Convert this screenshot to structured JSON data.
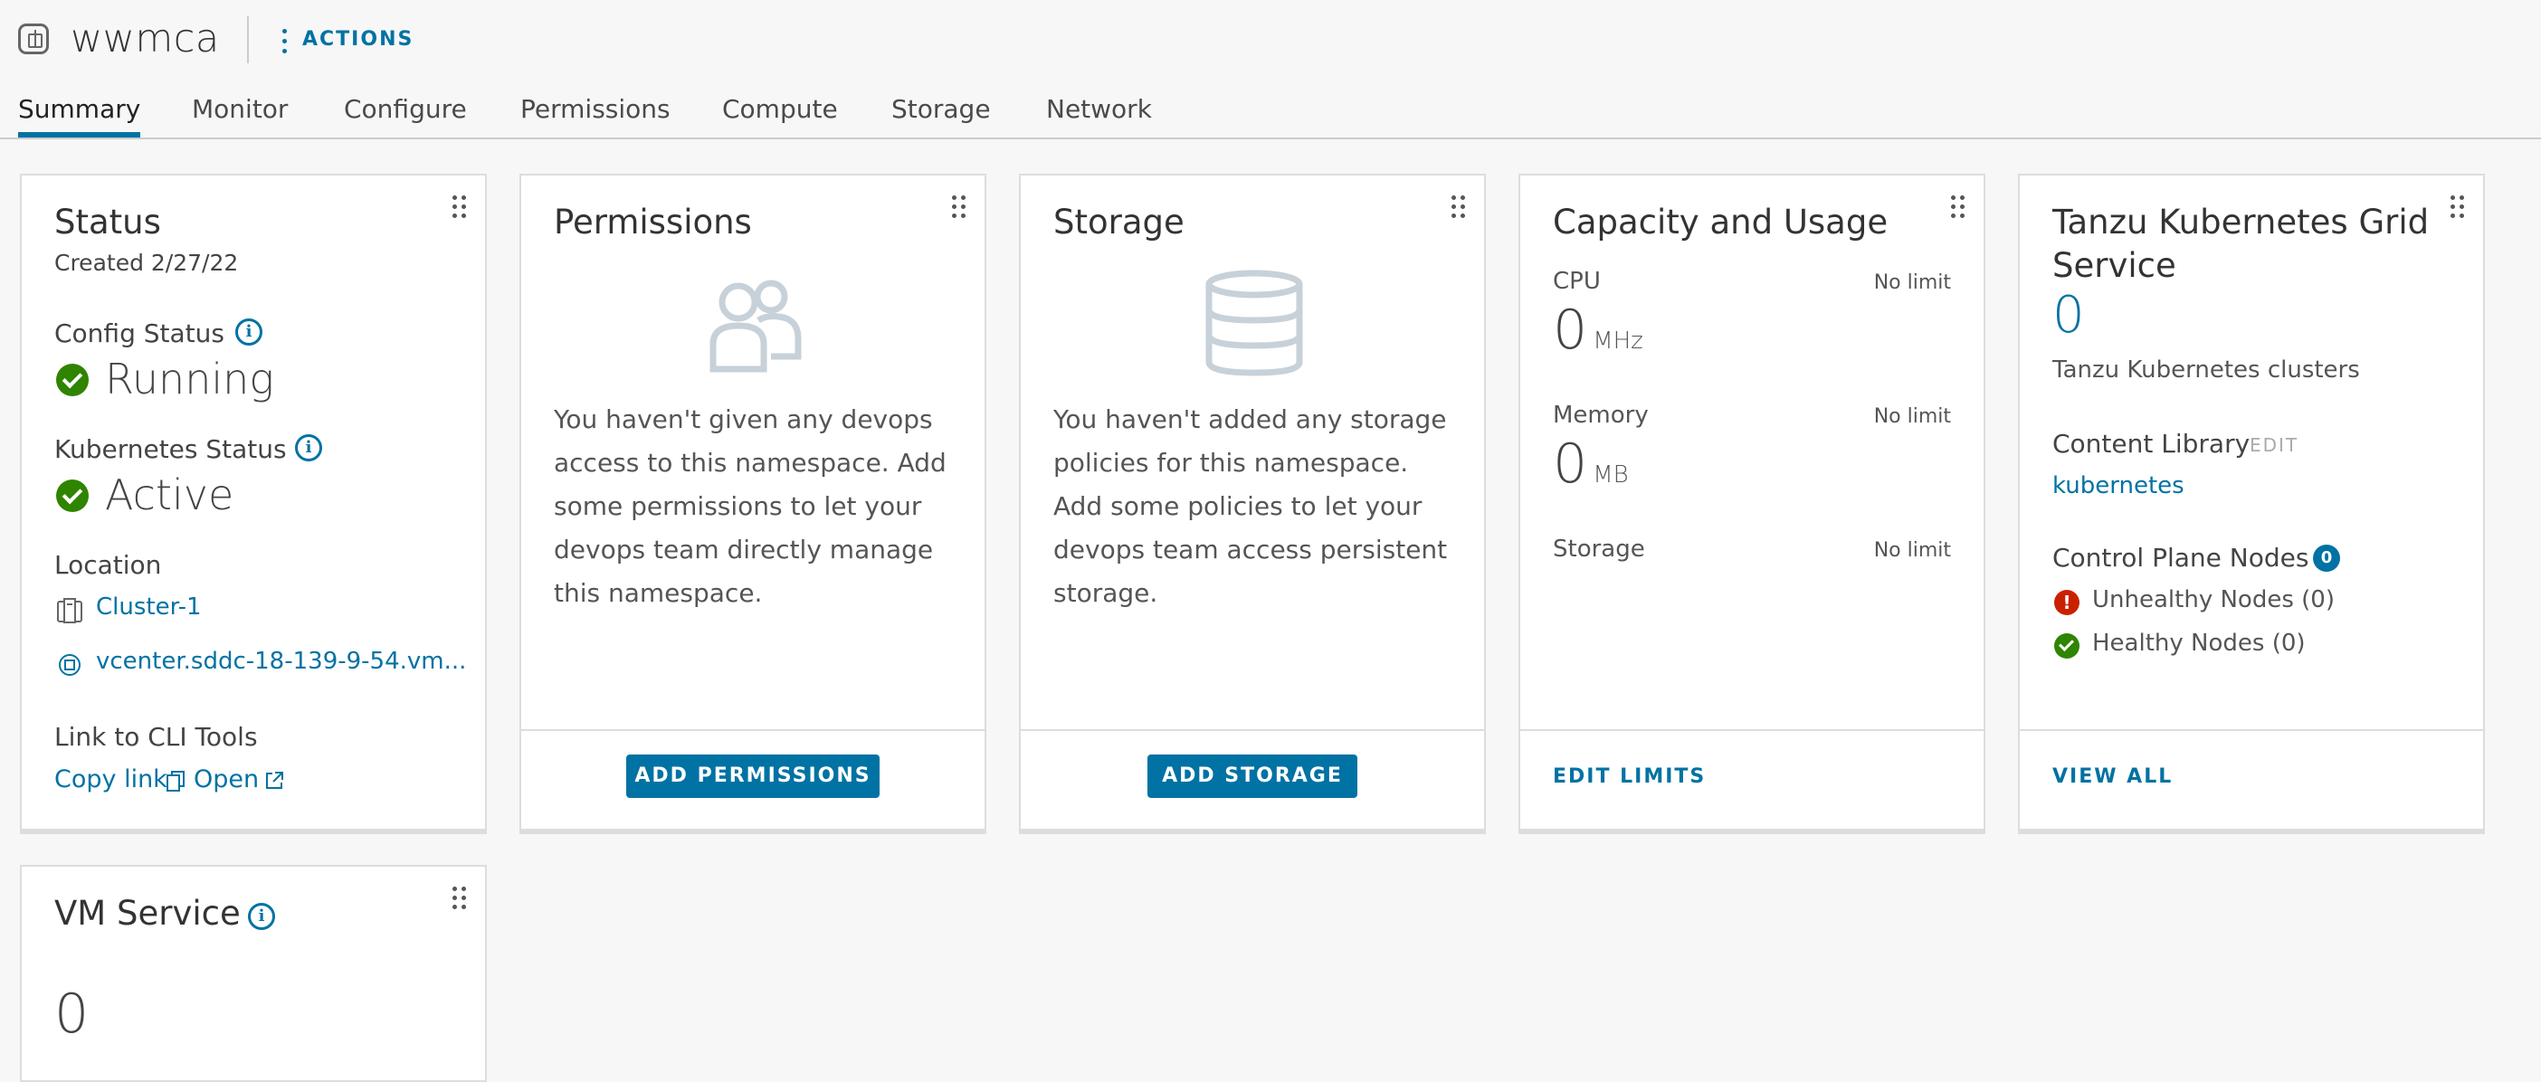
{
  "header": {
    "title": "wwmca",
    "actions_label": "ACTIONS"
  },
  "tabs": [
    {
      "label": "Summary",
      "active": true
    },
    {
      "label": "Monitor"
    },
    {
      "label": "Configure"
    },
    {
      "label": "Permissions"
    },
    {
      "label": "Compute"
    },
    {
      "label": "Storage"
    },
    {
      "label": "Network"
    }
  ],
  "status_card": {
    "title": "Status",
    "created": "Created 2/27/22",
    "config_status_label": "Config Status",
    "config_status_value": "Running",
    "k8s_status_label": "Kubernetes Status",
    "k8s_status_value": "Active",
    "location_label": "Location",
    "cluster_link": "Cluster-1",
    "vcenter_link": "vcenter.sddc-18-139-9-54.vm...",
    "cli_label": "Link to CLI Tools",
    "copy_link": "Copy link",
    "open_link": "Open"
  },
  "permissions_card": {
    "title": "Permissions",
    "message": "You haven't given any devops access to this namespace. Add some permissions to let your devops team directly manage this namespace.",
    "button": "ADD PERMISSIONS"
  },
  "storage_card": {
    "title": "Storage",
    "message": "You haven't added any storage policies for this namespace. Add some policies to let your devops team access persistent storage.",
    "button": "ADD STORAGE"
  },
  "capacity_card": {
    "title": "Capacity and Usage",
    "cpu_label": "CPU",
    "cpu_limit": "No limit",
    "cpu_value": "0",
    "cpu_unit": "MHz",
    "memory_label": "Memory",
    "memory_limit": "No limit",
    "memory_value": "0",
    "memory_unit": "MB",
    "storage_label": "Storage",
    "storage_limit": "No limit",
    "button": "EDIT LIMITS"
  },
  "tkg_card": {
    "title": "Tanzu Kubernetes Grid Service",
    "count": "0",
    "count_label": "Tanzu Kubernetes clusters",
    "content_library_label": "Content Library",
    "edit_label": "EDIT",
    "library_link": "kubernetes",
    "control_plane_label": "Control Plane Nodes",
    "control_plane_count": "0",
    "unhealthy": "Unhealthy Nodes (0)",
    "healthy": "Healthy Nodes (0)",
    "button": "VIEW ALL"
  },
  "vm_card": {
    "title": "VM Service",
    "count": "0"
  },
  "colors": {
    "accent": "#0072a3",
    "success": "#2f8400",
    "danger": "#c92100"
  }
}
